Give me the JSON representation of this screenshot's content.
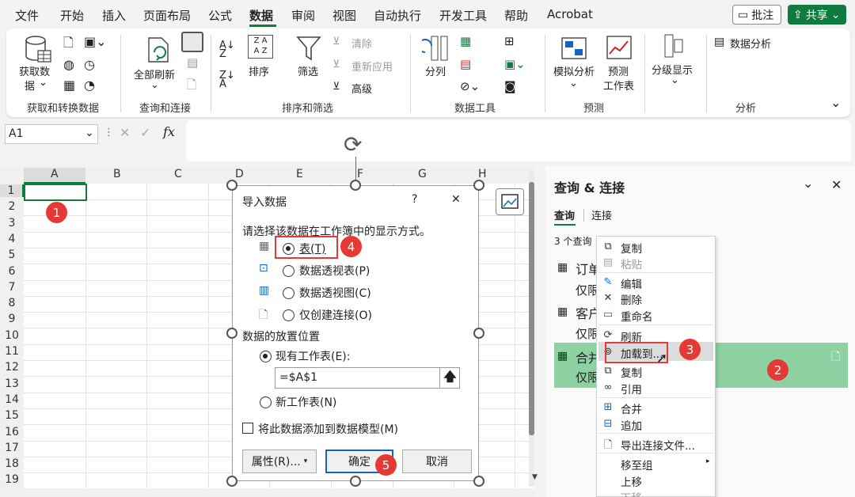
{
  "menu_tabs": [
    "文件",
    "开始",
    "插入",
    "页面布局",
    "公式",
    "数据",
    "审阅",
    "视图",
    "自动执行",
    "开发工具",
    "帮助",
    "Acrobat"
  ],
  "active_tab": "数据",
  "top_buttons": {
    "comment": "批注",
    "share": "共享"
  },
  "ribbon": {
    "get_data": "获取数",
    "get_data2": "据",
    "group_get": "获取和转换数据",
    "refresh_all": "全部刷新",
    "group_query": "查询和连接",
    "sort": "排序",
    "filter": "筛选",
    "clear": "清除",
    "reapply": "重新应用",
    "advanced": "高级",
    "group_sort": "排序和筛选",
    "split": "分列",
    "group_tools": "数据工具",
    "whatif": "模拟分析",
    "forecast1": "预测",
    "forecast2": "工作表",
    "group_forecast": "预测",
    "outline": "分级显示",
    "analysis": "数据分析",
    "group_analysis": "分析"
  },
  "formula_bar": {
    "name_box": "A1",
    "fx": "fx"
  },
  "columns": [
    "A",
    "B",
    "C",
    "D",
    "E",
    "F",
    "G",
    "H"
  ],
  "rows": [
    "1",
    "2",
    "3",
    "4",
    "5",
    "6",
    "7",
    "8",
    "9",
    "10",
    "11",
    "12",
    "13",
    "14",
    "15",
    "16",
    "17",
    "18",
    "19"
  ],
  "badges": [
    "1",
    "2",
    "3",
    "4",
    "5"
  ],
  "dialog": {
    "title": "导入数据",
    "help": "?",
    "close": "✕",
    "prompt": "请选择该数据在工作簿中的显示方式。",
    "options": [
      "表(T)",
      "数据透视表(P)",
      "数据透视图(C)",
      "仅创建连接(O)"
    ],
    "selected_option": "表(T)",
    "placement_label": "数据的放置位置",
    "existing": "现有工作表(E):",
    "location": "=$A$1",
    "new_sheet": "新工作表(N)",
    "add_model": "将此数据添加到数据模型(M)",
    "properties": "属性(R)...",
    "ok": "确定",
    "cancel": "取消"
  },
  "panel": {
    "title": "查询 & 连接",
    "tab_query": "查询",
    "tab_conn": "连接",
    "count": "3 个查询",
    "items": [
      {
        "name": "订单",
        "sub": "仅限"
      },
      {
        "name": "客户",
        "sub": "仅限"
      },
      {
        "name": "合并",
        "sub": "仅限"
      }
    ]
  },
  "context_menu": {
    "items": [
      "复制",
      "粘贴",
      "编辑",
      "删除",
      "重命名",
      "刷新",
      "加载到...",
      "复制",
      "引用",
      "合并",
      "追加",
      "导出连接文件...",
      "移至组",
      "上移",
      "下移"
    ],
    "disabled": [
      "粘贴"
    ],
    "highlight": "加载到..."
  },
  "colors": {
    "accent_green": "#107c41",
    "badge_red": "#e53935",
    "selected_row": "#8ed1a3"
  }
}
